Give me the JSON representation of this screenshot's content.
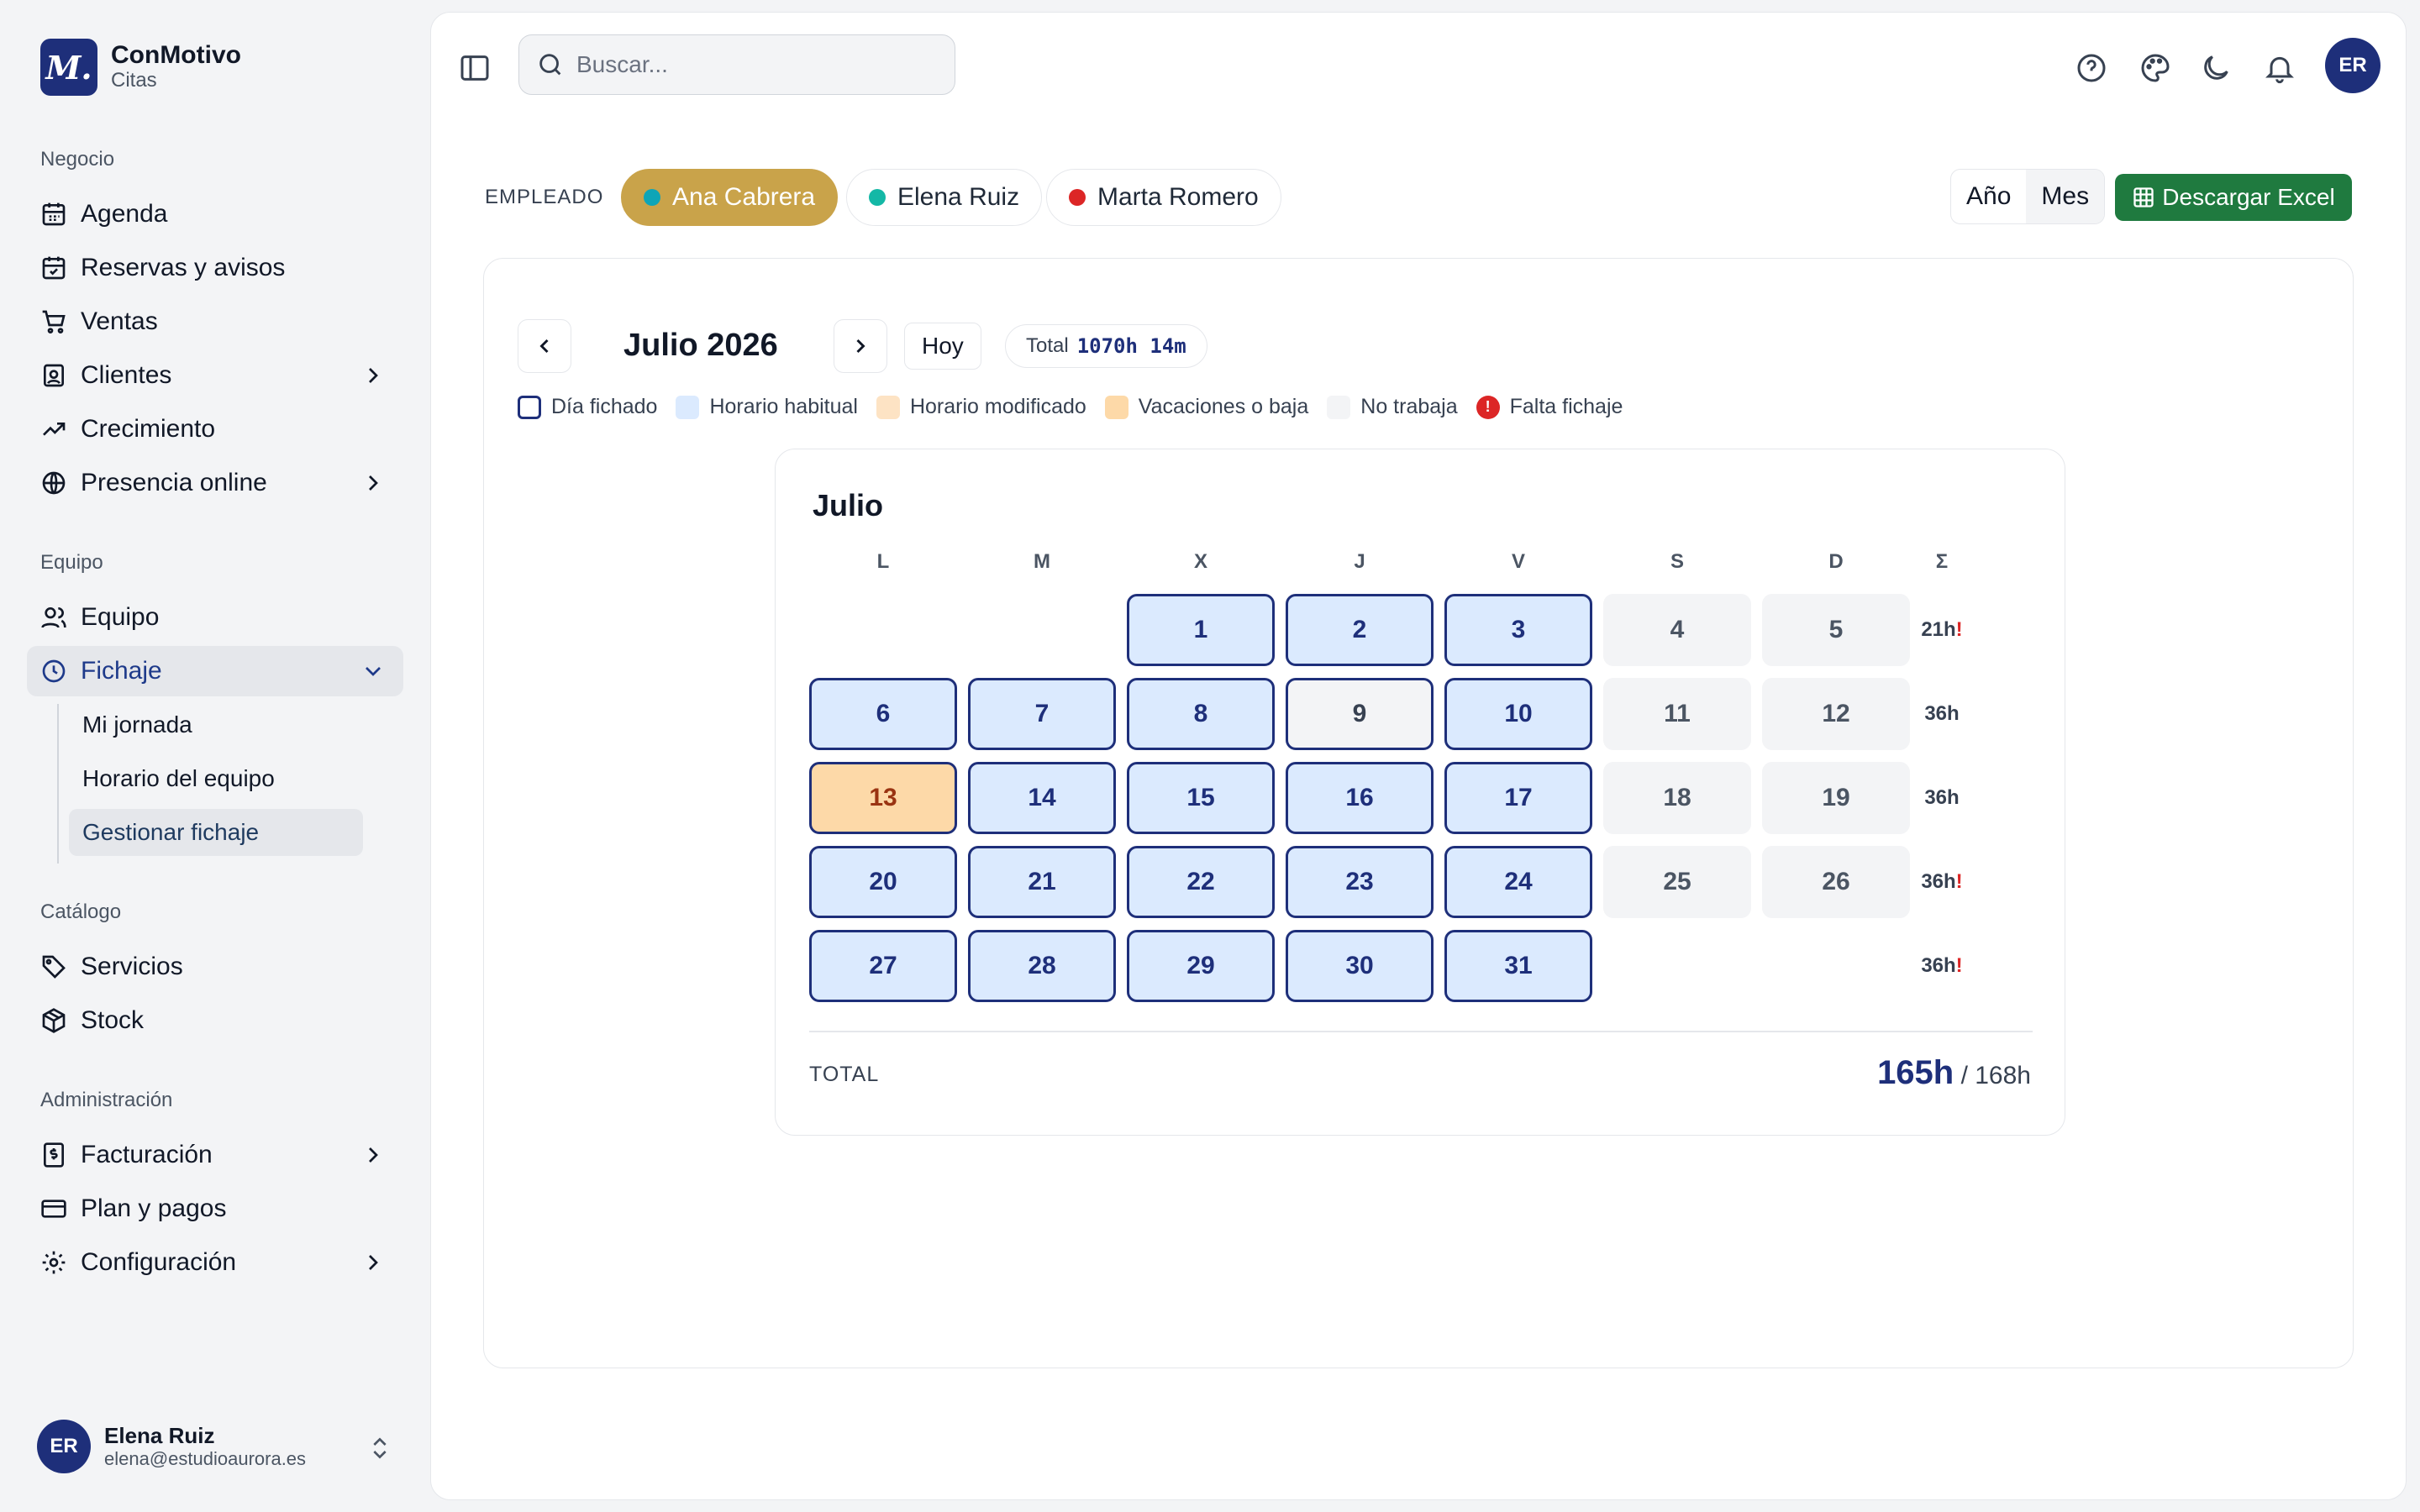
{
  "brand": {
    "logo": "M.",
    "name": "ConMotivo",
    "sub": "Citas"
  },
  "sidebar": {
    "sections": [
      "Negocio",
      "Equipo",
      "Catálogo",
      "Administración"
    ],
    "negocio": [
      "Agenda",
      "Reservas y avisos",
      "Ventas",
      "Clientes",
      "Crecimiento",
      "Presencia online"
    ],
    "equipo": [
      "Equipo",
      "Fichaje"
    ],
    "fichaje_sub": [
      "Mi jornada",
      "Horario del equipo",
      "Gestionar fichaje"
    ],
    "catalogo": [
      "Servicios",
      "Stock"
    ],
    "admin": [
      "Facturación",
      "Plan y pagos",
      "Configuración"
    ],
    "icons": [
      "calendar-icon",
      "calendar-check-icon",
      "cart-icon",
      "contact-icon",
      "trending-up-icon",
      "globe-icon",
      "users-icon",
      "clock-icon",
      "tag-icon",
      "box-icon",
      "receipt-icon",
      "credit-card-icon",
      "gear-icon"
    ]
  },
  "user": {
    "initials": "ER",
    "name": "Elena Ruiz",
    "email": "elena@estudioaurora.es"
  },
  "topbar": {
    "search_placeholder": "Buscar...",
    "avatar": "ER"
  },
  "employees": {
    "label": "EMPLEADO",
    "items": [
      {
        "name": "Ana Cabrera",
        "color": "#0ea5b7",
        "active": true
      },
      {
        "name": "Elena Ruiz",
        "color": "#14b8a6",
        "active": false
      },
      {
        "name": "Marta Romero",
        "color": "#dc2626",
        "active": false
      }
    ]
  },
  "view": {
    "year": "Año",
    "month": "Mes",
    "selected": "Mes"
  },
  "excel_label": "Descargar Excel",
  "calendar": {
    "title": "Julio 2026",
    "today": "Hoy",
    "total_label": "Total",
    "total_value": "1070h 14m",
    "legend": [
      "Día fichado",
      "Horario habitual",
      "Horario modificado",
      "Vacaciones o baja",
      "No trabaja",
      "Falta fichaje"
    ],
    "legend_falta_glyph": "!",
    "month_name": "Julio",
    "dow": [
      "L",
      "M",
      "X",
      "J",
      "V",
      "S",
      "D",
      "Σ"
    ],
    "days": [
      "1",
      "2",
      "3",
      "4",
      "5",
      "6",
      "7",
      "8",
      "9",
      "10",
      "11",
      "12",
      "13",
      "14",
      "15",
      "16",
      "17",
      "18",
      "19",
      "20",
      "21",
      "22",
      "23",
      "24",
      "25",
      "26",
      "27",
      "28",
      "29",
      "30",
      "31"
    ],
    "week_totals": [
      "21h",
      "36h",
      "36h",
      "36h",
      "36h"
    ],
    "week_warn": [
      "!",
      "",
      "",
      "!",
      "!"
    ],
    "total_row_label": "TOTAL",
    "month_worked": "165h",
    "month_expected": "/ 168h"
  },
  "colors": {
    "accent": "#1e2f7a",
    "active_chip": "#c9a34a",
    "excel": "#1f7a3f",
    "warn": "#dc2626"
  }
}
